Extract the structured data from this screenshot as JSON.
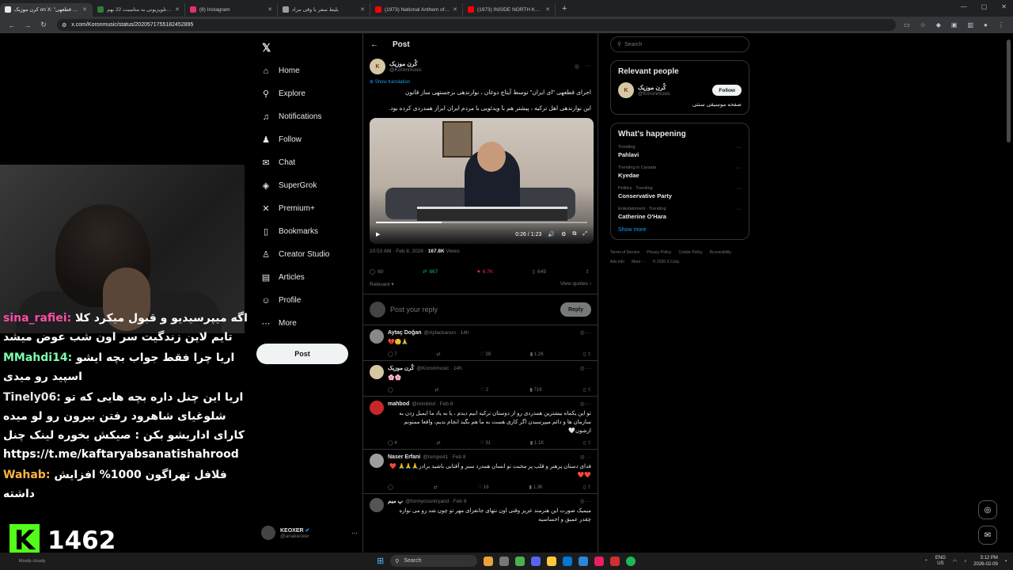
{
  "browser": {
    "tabs": [
      {
        "title": "کرن موزیک on X: \"اجرای قطعهی",
        "color": "#e7e9ea",
        "active": true
      },
      {
        "title": "پیام تلویزیونی به مناسبت 22 بهم",
        "color": "#2e7d32",
        "active": false
      },
      {
        "title": "(8) Instagram",
        "color": "#e1306c",
        "active": false
      },
      {
        "title": "بلیط سفر با وقی مراد",
        "color": "#9e9e9e",
        "active": false
      },
      {
        "title": "(1973) National Anthem of Iran",
        "color": "#ff0000",
        "active": false
      },
      {
        "title": "(1973) INSIDE NORTH KOREA",
        "color": "#ff0000",
        "active": false
      }
    ],
    "url": "x.com/Koronmusic/status/2020571755182452895"
  },
  "stream": {
    "chat": [
      {
        "user": "sina_rafiei:",
        "text": "اگه میپرسیدیو و قبول میکرد کلا تایم لاین زندگیت سر اون شب عوض میشد",
        "color": "#ff4da6"
      },
      {
        "user": "MMahdi14:",
        "text": "اریا چرا فقط جواب بچه ایشو اسپید رو میدی",
        "color": "#7dffb0"
      },
      {
        "user": "Tinely06:",
        "text": "اریا این چنل داره بچه هایی که تو شلوغیای شاهرود رفتن بیرون رو لو میده کارای اداریشو بکن : صیکش بخوره لینک چنل https://t.me/kaftaryabsanatishahrood",
        "color": "#e8e8e8"
      },
      {
        "user": "Wahab:",
        "text": "فلافل تهراگون 1000% افزایش داشته",
        "color": "#ffb347"
      }
    ],
    "viewer_count": "1462",
    "kick_letter": "K"
  },
  "nav": {
    "items": [
      {
        "label": "Home",
        "icon": "home-icon",
        "glyph": "⌂"
      },
      {
        "label": "Explore",
        "icon": "search-icon",
        "glyph": "⚲"
      },
      {
        "label": "Notifications",
        "icon": "bell-icon",
        "glyph": "♫"
      },
      {
        "label": "Follow",
        "icon": "follow-icon",
        "glyph": "♟"
      },
      {
        "label": "Chat",
        "icon": "chat-icon",
        "glyph": "✉"
      },
      {
        "label": "SuperGrok",
        "icon": "grok-icon",
        "glyph": "◈"
      },
      {
        "label": "Premium+",
        "icon": "x-premium-icon",
        "glyph": "✕"
      },
      {
        "label": "Bookmarks",
        "icon": "bookmark-icon",
        "glyph": "▯"
      },
      {
        "label": "Creator Studio",
        "icon": "creator-icon",
        "glyph": "♙"
      },
      {
        "label": "Articles",
        "icon": "articles-icon",
        "glyph": "▤"
      },
      {
        "label": "Profile",
        "icon": "profile-icon",
        "glyph": "☺"
      },
      {
        "label": "More",
        "icon": "more-icon",
        "glyph": "⋯"
      }
    ],
    "post_label": "Post",
    "account": {
      "name": "KEOXER",
      "handle": "@ariakeoxer"
    }
  },
  "post": {
    "header": "Post",
    "author": "کُرن موزیک",
    "handle": "@Koronmusic",
    "show_translation": "Show translation",
    "body_1": "اجرای قطعهی \"ای ایران\" توسط آیتاچ دوغان ، نوازندهی برجستهی ساز قانون",
    "body_2": "این نوازندهی اهل ترکیه ، پیشتر هم با ویدئویی با مردم ایران ابراز همدردی کرده بود.",
    "video_time": "0:26 / 1:23",
    "video_progress": 0.31,
    "timestamp": "10:53 AM · Feb 8, 2026 ·",
    "views": "167.8K",
    "views_label": "Views",
    "stats": {
      "replies": "60",
      "reposts": "867",
      "likes": "6.7K",
      "bookmarks": "649"
    },
    "relevant": "Relevant",
    "view_quotes": "View quotes",
    "reply_placeholder": "Post your reply",
    "reply_button": "Reply"
  },
  "replies": [
    {
      "name": "Aytaç Doğan",
      "handle": "@Aytackanun · 14h",
      "text": "💔🙂🙏",
      "rtl": false,
      "stats": [
        "7",
        "",
        "39",
        "1.2K"
      ],
      "avatar": "#888"
    },
    {
      "name": "کُرن موزیک",
      "handle": "@Koronmusic · 14h",
      "text": "🌸🌸",
      "rtl": false,
      "stats": [
        "",
        "",
        "2",
        "719"
      ],
      "avatar": "#d6c7a4"
    },
    {
      "name": "mahbod",
      "handle": "@mimbnd · Feb 8",
      "text": "تو این یکماه بیشترین همدردی رو از دوستان ترکیه ابیم دیدم ، یا به یاد ما ایمیل زدن به سازمان ها و دائم میپرسیدن اگر کاری هست به ما هم بگید انجام بدیم، واقعا ممنونم ازشون🤍",
      "rtl": true,
      "stats": [
        "4",
        "",
        "31",
        "1.1K"
      ],
      "avatar": "#c62828"
    },
    {
      "name": "Naser Erfani",
      "handle": "@tompe41 · Feb 8",
      "text": "فدای دستان پرهنر و قلب پر محبت تو انسان همدرد سبز و آفتابی باشید برادر🙏🙏🙏 ❤️❤️❤️",
      "rtl": true,
      "stats": [
        "",
        "",
        "16",
        "1.3K"
      ],
      "avatar": "#9e9e9e"
    },
    {
      "name": "پ میم",
      "handle": "@formycountryand · Feb 8",
      "text": "میمیک صورت این هنرمند عزیز وقتی اون نتهای جانفزای مهر تو چون شد رو می نوازه چقدر عمیق و احساسیه",
      "rtl": true,
      "stats": [
        "",
        "",
        "",
        ""
      ],
      "avatar": "#555"
    }
  ],
  "sidebar": {
    "search_placeholder": "Search",
    "relevant_title": "Relevant people",
    "person": {
      "name": "کُرن موزیک",
      "handle": "@Koronmusic",
      "bio": "صفحه موسیقی سنتی",
      "follow": "Follow"
    },
    "happening_title": "What's happening",
    "trends": [
      {
        "category": "Trending",
        "name": "Pahlavi"
      },
      {
        "category": "Trending in Canada",
        "name": "Kyedae"
      },
      {
        "category": "Politics · Trending",
        "name": "Conservative Party"
      },
      {
        "category": "Entertainment · Trending",
        "name": "Catherine O'Hara"
      }
    ],
    "show_more": "Show more",
    "footer": [
      "Terms of Service",
      "Privacy Policy",
      "Cookie Policy",
      "Accessibility",
      "Ads info",
      "More ···",
      "© 2026 X Corp."
    ]
  },
  "taskbar": {
    "weather": "Mostly cloudy",
    "search": "Search",
    "lang": "ENG",
    "region": "US",
    "time": "3:12 PM",
    "date": "2026-02-09"
  }
}
